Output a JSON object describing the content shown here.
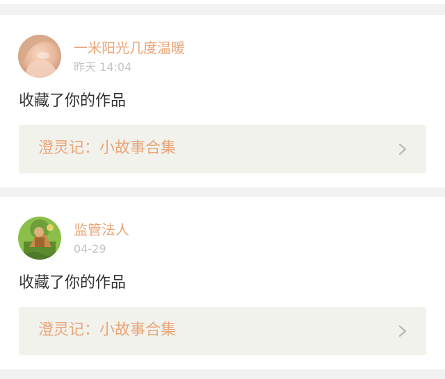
{
  "notifications": [
    {
      "user_name": "一米阳光几度温暖",
      "time": "昨天 14:04",
      "action": "收藏了你的作品",
      "work_title": "澄灵记：小故事合集",
      "avatar": "portrait-avatar"
    },
    {
      "user_name": "监管法人",
      "time": "04-29",
      "action": "收藏了你的作品",
      "work_title": "澄灵记：小故事合集",
      "avatar": "cartoon-avatar"
    }
  ],
  "colors": {
    "accent": "#e9a57a",
    "card_background": "#ffffff",
    "page_background": "#f2f2f2",
    "work_background": "#f2f2ec",
    "time_text": "#c4c4c4",
    "body_text": "#333333"
  }
}
